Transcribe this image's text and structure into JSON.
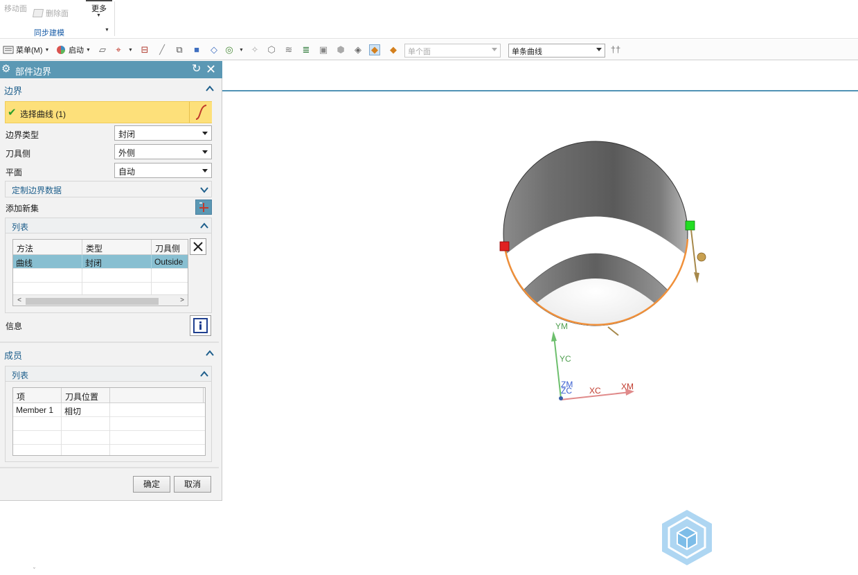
{
  "ribbon": {
    "move_face": "移动面",
    "delete_face": "删除面",
    "more": "更多",
    "group_label": "同步建模"
  },
  "toolbar": {
    "menu": "菜单(M)",
    "start": "启动",
    "face_filter": "单个面",
    "curve_rule": "单条曲线"
  },
  "dialog": {
    "title": "部件边界",
    "boundary": {
      "title": "边界",
      "select_curve": "选择曲线 (1)",
      "boundary_type_label": "边界类型",
      "boundary_type_value": "封闭",
      "tool_side_label": "刀具侧",
      "tool_side_value": "外侧",
      "plane_label": "平面",
      "plane_value": "自动",
      "custom_data": "定制边界数据",
      "add_new_set": "添加新集",
      "list_title": "列表",
      "columns": [
        "方法",
        "类型",
        "刀具侧"
      ],
      "rows": [
        [
          "曲线",
          "封闭",
          "Outside"
        ]
      ],
      "info_label": "信息"
    },
    "members": {
      "title": "成员",
      "list_title": "列表",
      "columns": [
        "项",
        "刀具位置"
      ],
      "rows": [
        [
          "Member 1",
          "相切"
        ]
      ]
    },
    "ok": "确定",
    "cancel": "取消"
  },
  "scene": {
    "labels": {
      "ym": "YM",
      "yc": "YC",
      "zm": "ZM",
      "zc": "ZC",
      "xc": "XC",
      "xm": "XM"
    }
  },
  "colors": {
    "title_bar": "#5b98b4",
    "selection": "#fde07a",
    "selected_row": "#88bfd1",
    "section_text": "#1e5f8c",
    "boundary_curve": "#f0903a"
  }
}
